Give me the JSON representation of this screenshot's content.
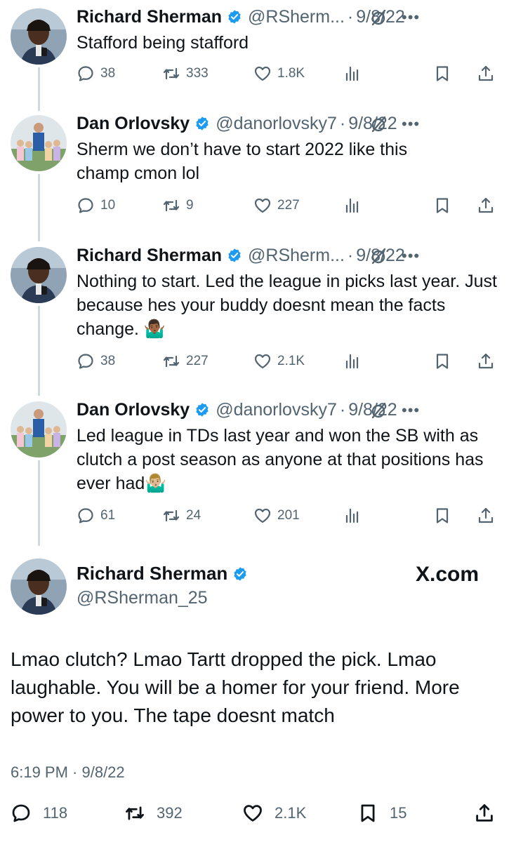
{
  "replies": [
    {
      "name": "Richard Sherman",
      "handle": "@RSherm...",
      "date": "9/8/22",
      "text": "Stafford being stafford",
      "replies": "38",
      "retweets": "333",
      "likes": "1.8K"
    },
    {
      "name": "Dan Orlovsky",
      "handle": "@danorlovsky7",
      "date": "9/8/22",
      "text": "Sherm we don’t have to start 2022 like this champ cmon lol",
      "replies": "10",
      "retweets": "9",
      "likes": "227"
    },
    {
      "name": "Richard Sherman",
      "handle": "@RSherm...",
      "date": "9/8/22",
      "text": "Nothing to start.  Led the league in picks last year.  Just because hes your buddy doesnt mean the facts change. 🤷🏾‍♂️",
      "replies": "38",
      "retweets": "227",
      "likes": "2.1K"
    },
    {
      "name": "Dan Orlovsky",
      "handle": "@danorlovsky7",
      "date": "9/8/22",
      "text": "Led league in TDs last year and won the SB with as clutch a post season as anyone at that positions has ever had🤷🏼‍♂️",
      "replies": "61",
      "retweets": "24",
      "likes": "201"
    }
  ],
  "main_tweet": {
    "name": "Richard Sherman",
    "handle": "@RSherman_25",
    "watermark": "X.com",
    "text": "Lmao clutch? Lmao Tartt dropped the pick.  Lmao laughable.  You will be a homer for your friend.  More power to you.  The tape doesnt match",
    "time": "6:19 PM · 9/8/22",
    "replies": "118",
    "retweets": "392",
    "likes": "2.1K",
    "bookmarks": "15"
  },
  "colors": {
    "verified_badge": "#1d9bf0",
    "secondary_text": "#536471",
    "thread_line": "#cfd9de"
  },
  "icons": [
    "reply-icon",
    "retweet-icon",
    "like-icon",
    "views-icon",
    "bookmark-icon",
    "share-icon",
    "grok-icon",
    "more-icon",
    "verified-badge-icon"
  ]
}
